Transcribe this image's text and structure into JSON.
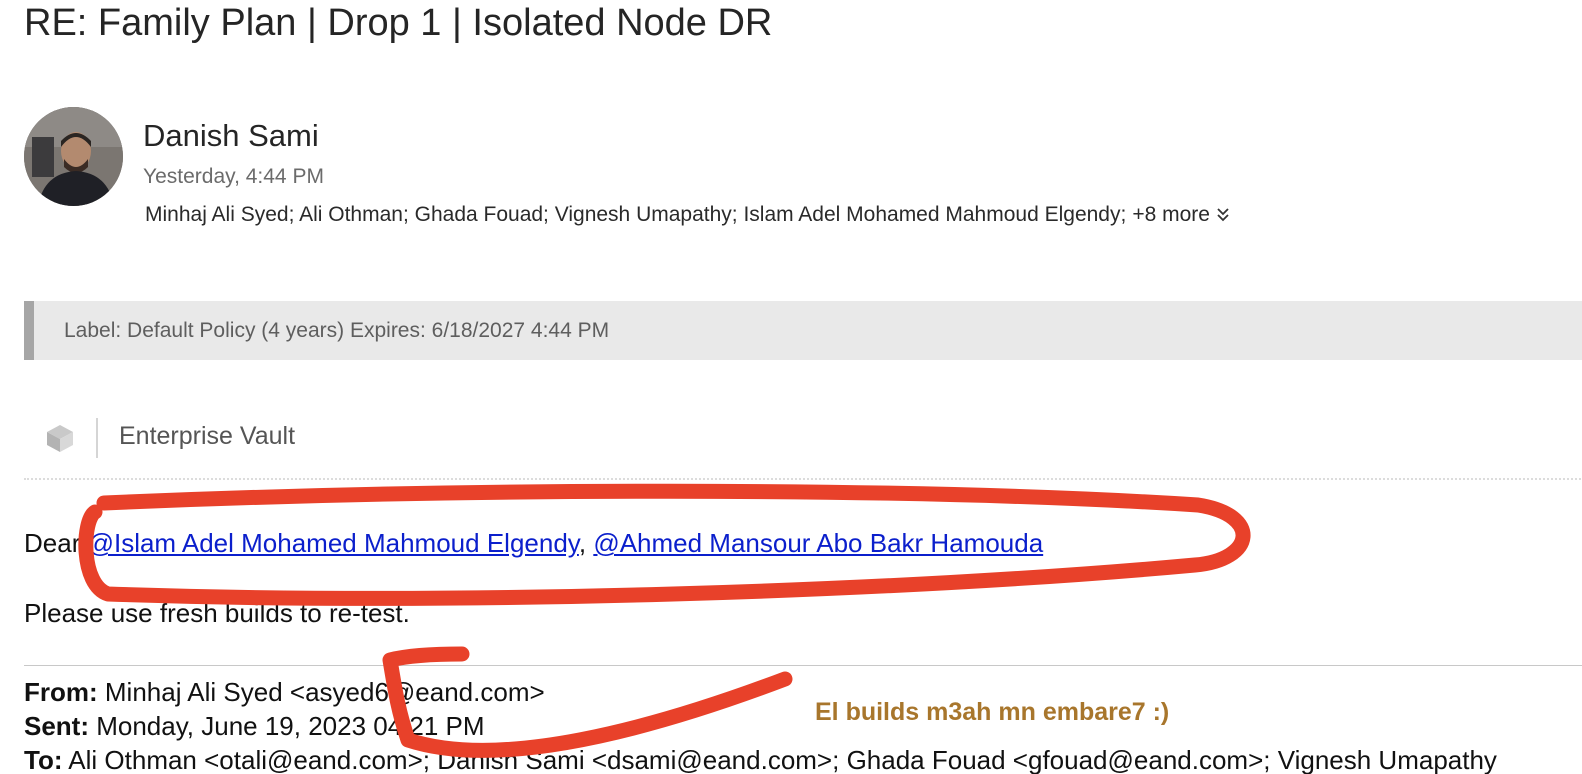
{
  "message": {
    "subject": "RE: Family Plan | Drop 1 | Isolated Node DR",
    "sender_name": "Danish Sami",
    "sent_time": "Yesterday, 4:44 PM",
    "recipients": "Minhaj Ali Syed; Ali Othman; Ghada Fouad; Vignesh Umapathy; Islam Adel Mohamed Mahmoud Elgendy;",
    "more_recipients": "+8 more"
  },
  "retention_label": "Label: Default Policy (4 years) Expires: 6/18/2027 4:44 PM",
  "addin": {
    "name": "Enterprise Vault",
    "icon": "cube-icon"
  },
  "body": {
    "greeting_prefix": "Dear ",
    "mention_1": "@Islam Adel Mohamed Mahmoud Elgendy",
    "separator": ", ",
    "mention_2": "@Ahmed Mansour Abo Bakr Hamouda",
    "line_2": "Please use fresh builds to re-test."
  },
  "quoted_header": {
    "from_label": "From:",
    "from_value": " Minhaj Ali Syed <asyed6@eand.com>",
    "sent_label": "Sent:",
    "sent_value": " Monday, June 19, 2023 04:21 PM",
    "to_label": "To:",
    "to_value": " Ali Othman <otali@eand.com>; Danish Sami <dsami@eand.com>; Ghada Fouad <gfouad@eand.com>; Vignesh Umapathy"
  },
  "annotation": {
    "note": "El builds m3ah mn embare7 :)",
    "stroke_color": "#e8412a",
    "note_color": "#a8762c"
  },
  "colors": {
    "mention_link": "#0b1fcc",
    "label_bar_bg": "#e9e9e9",
    "label_bar_accent": "#a6a6a6"
  }
}
